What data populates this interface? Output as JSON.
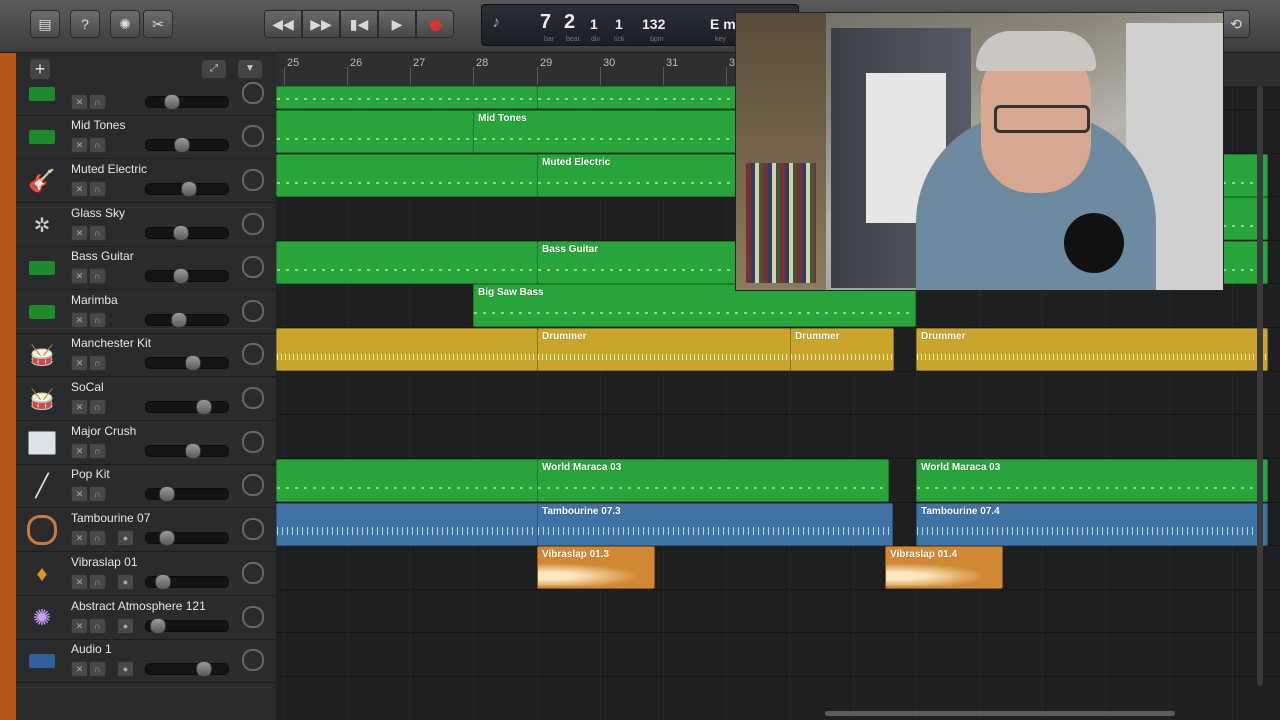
{
  "toolbar": {
    "lcd": {
      "bar": "7",
      "beat": "2",
      "div": "1",
      "tick": "1",
      "bpm": "132",
      "key": "E m",
      "bar_lbl": "bar",
      "beat_lbl": "beat",
      "div_lbl": "div",
      "tick_lbl": "tick",
      "bpm_lbl": "bpm",
      "key_lbl": "key"
    },
    "help": "?"
  },
  "ruler": {
    "bars": [
      "25",
      "26",
      "27",
      "28",
      "29",
      "30",
      "31",
      "3"
    ]
  },
  "header": {
    "add": "+"
  },
  "tracks": [
    {
      "name": "",
      "icon": "synth-keyboard-icon"
    },
    {
      "name": "Mid Tones",
      "icon": "synth-keyboard-icon"
    },
    {
      "name": "Muted Electric",
      "icon": "electric-guitar-icon"
    },
    {
      "name": "Glass Sky",
      "icon": "robot-icon"
    },
    {
      "name": "Bass Guitar",
      "icon": "synth-keyboard-icon"
    },
    {
      "name": "Marimba",
      "icon": "synth-keyboard-icon"
    },
    {
      "name": "Manchester Kit",
      "icon": "drum-kit-icon"
    },
    {
      "name": "SoCal",
      "icon": "drum-kit-icon"
    },
    {
      "name": "Major Crush",
      "icon": "drum-machine-icon"
    },
    {
      "name": "Pop Kit",
      "icon": "drumsticks-icon"
    },
    {
      "name": "Tambourine 07",
      "icon": "tambourine-icon"
    },
    {
      "name": "Vibraslap 01",
      "icon": "maracas-icon"
    },
    {
      "name": "Abstract Atmosphere 121",
      "icon": "sparkle-icon"
    },
    {
      "name": "Audio 1",
      "icon": "audio-waveform-icon"
    }
  ],
  "regions": {
    "mid_tones": "Mid Tones",
    "muted_electric": "Muted Electric",
    "bass_guitar": "Bass Guitar",
    "big_saw_bass": "Big Saw Bass",
    "drummer_1": "Drummer",
    "drummer_2": "Drummer",
    "drummer_3": "Drummer",
    "world_maraca_1": "World Maraca 03",
    "world_maraca_2": "World Maraca 03",
    "tambourine_1": "Tambourine 07.3",
    "tambourine_2": "Tambourine 07.4",
    "vibraslap_1": "Vibraslap 01.3",
    "vibraslap_2": "Vibraslap 01.4"
  },
  "colors": {
    "midi_region": "#27a43a",
    "drummer_region": "#c9a52c",
    "audio_loop_region": "#3f73a6",
    "audio_region": "#d08932",
    "accent": "#b8561c"
  }
}
